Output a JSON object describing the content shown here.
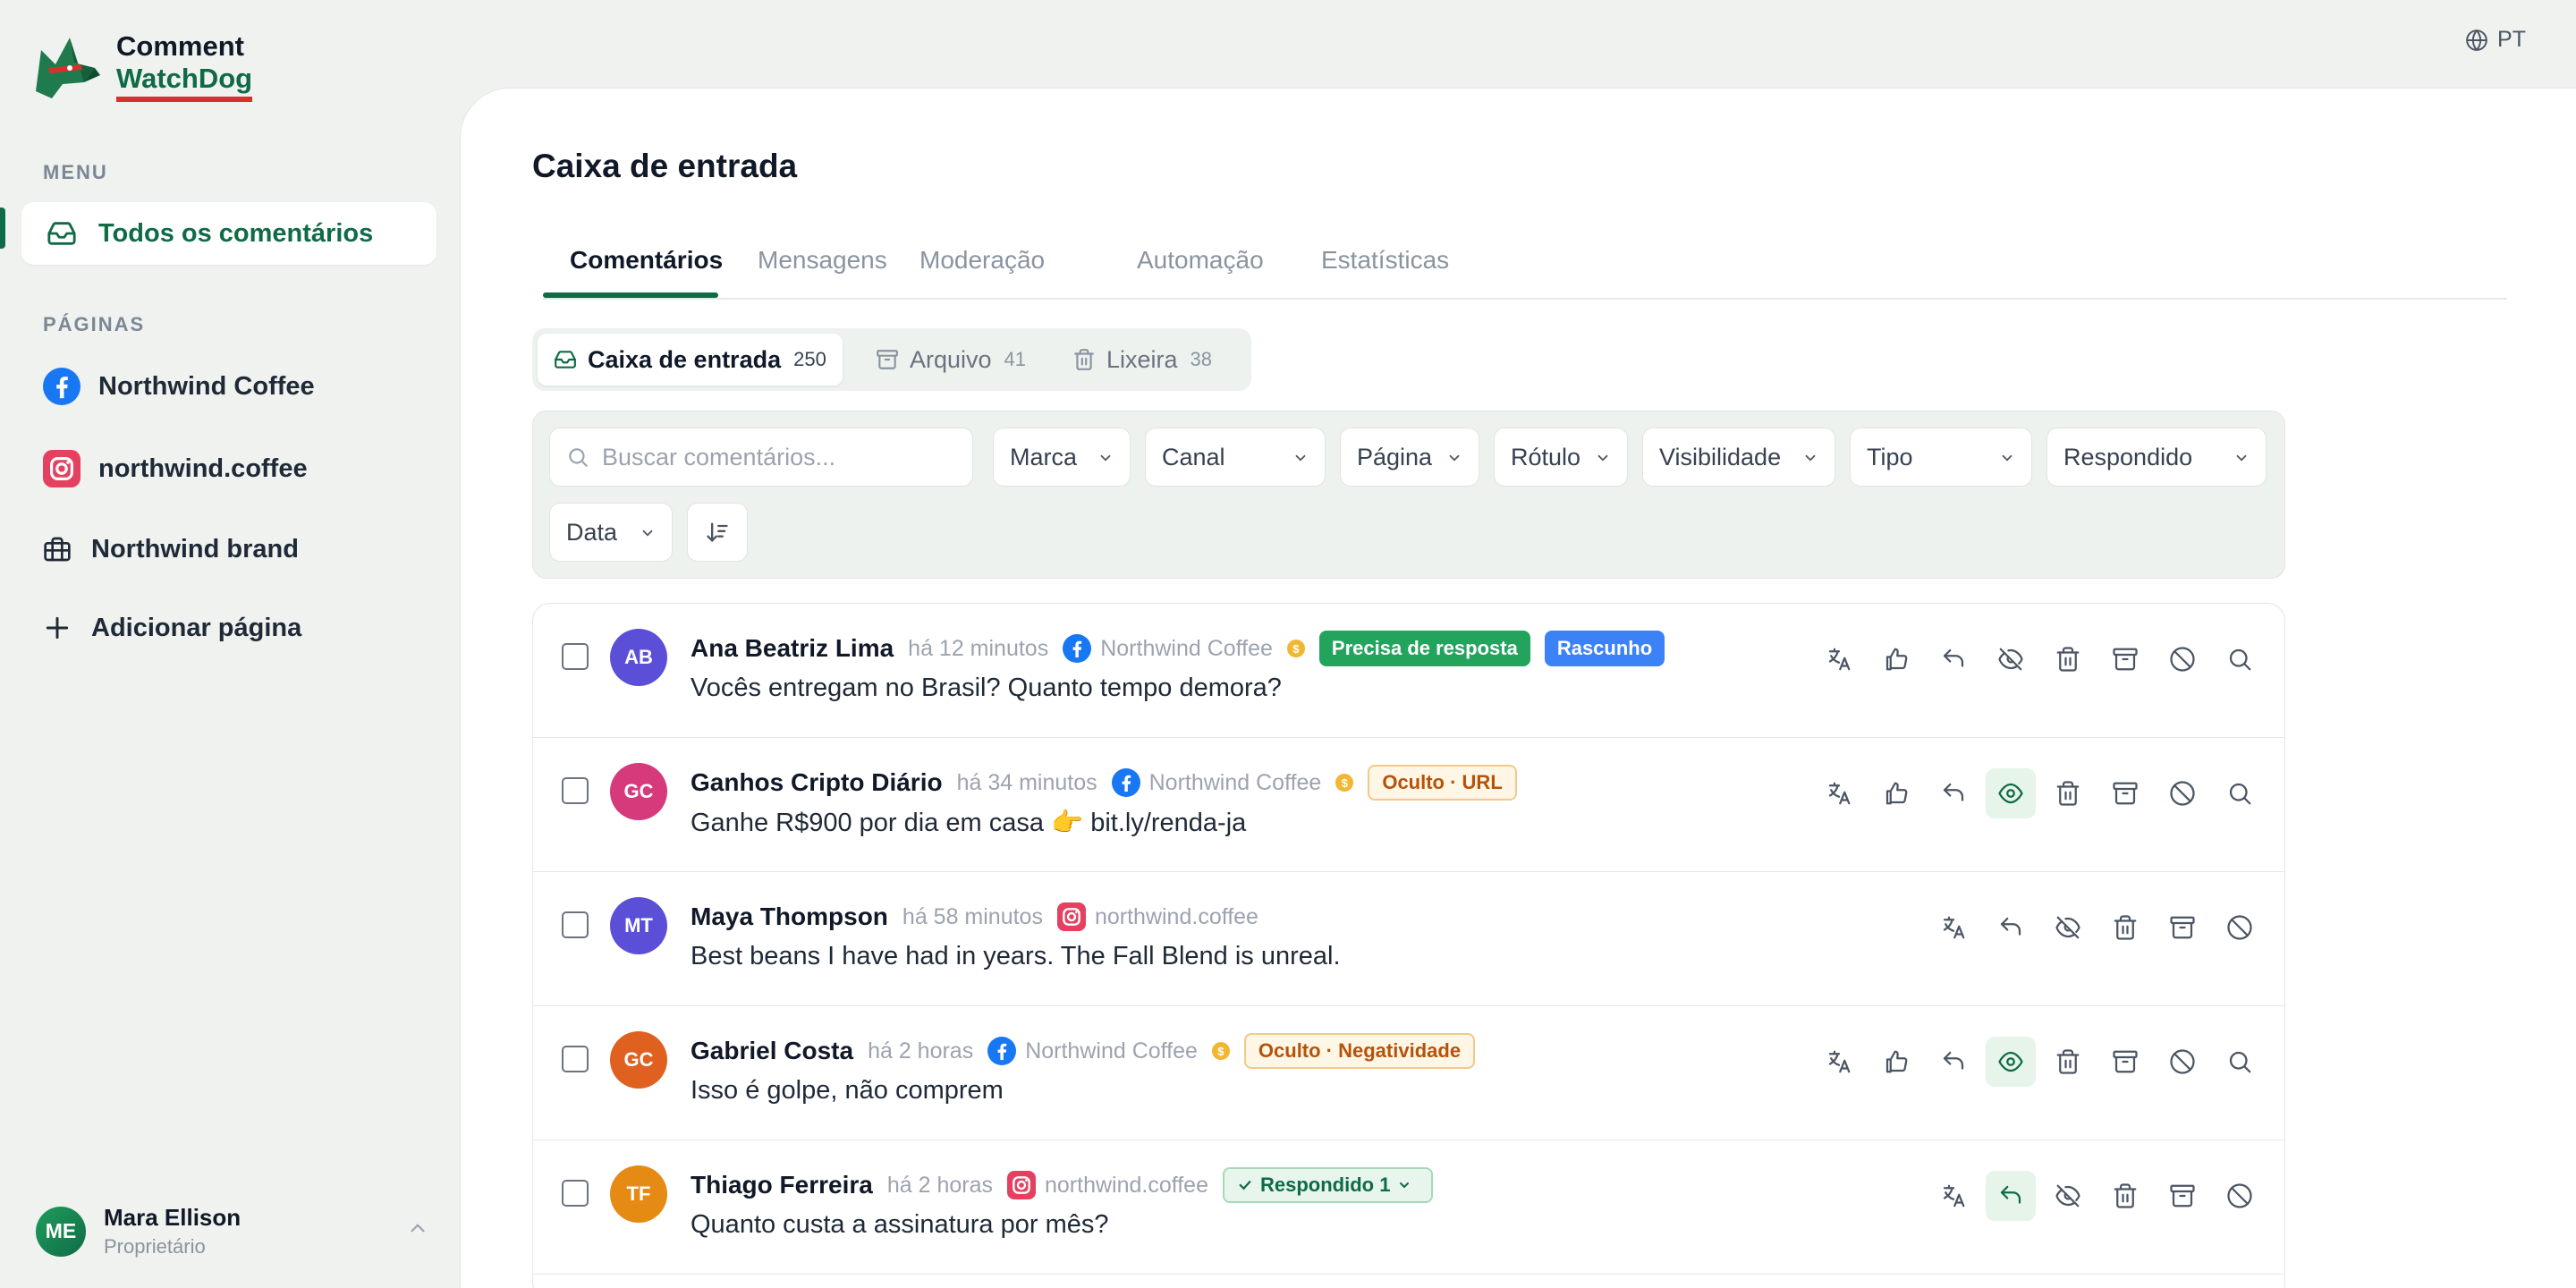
{
  "app": {
    "name_line1": "Comment",
    "name_line2": "WatchDog",
    "language": "PT"
  },
  "sidebar": {
    "menu_label": "MENU",
    "menu_items": [
      {
        "label": "Todos os comentários",
        "icon": "inbox-icon",
        "active": true
      }
    ],
    "pages_label": "PÁGINAS",
    "pages": [
      {
        "label": "Northwind Coffee",
        "icon": "facebook-icon"
      },
      {
        "label": "northwind.coffee",
        "icon": "instagram-icon"
      },
      {
        "label": "Northwind brand",
        "icon": "briefcase-icon"
      },
      {
        "label": "Adicionar página",
        "icon": "plus-icon"
      }
    ],
    "user": {
      "initials": "ME",
      "name": "Mara Ellison",
      "role": "Proprietário"
    }
  },
  "main": {
    "title": "Caixa de entrada",
    "tabs": [
      {
        "label": "Comentários",
        "active": true
      },
      {
        "label": "Mensagens"
      },
      {
        "label": "Moderação"
      },
      {
        "label": "Automação"
      },
      {
        "label": "Estatísticas"
      }
    ],
    "folders": [
      {
        "label": "Caixa de entrada",
        "count": "250",
        "icon": "inbox-icon",
        "active": true
      },
      {
        "label": "Arquivo",
        "count": "41",
        "icon": "archive-icon"
      },
      {
        "label": "Lixeira",
        "count": "38",
        "icon": "trash-icon"
      }
    ],
    "search_placeholder": "Buscar comentários...",
    "filters": [
      "Marca",
      "Canal",
      "Página",
      "Rótulo",
      "Visibilidade",
      "Tipo",
      "Respondido",
      "Data"
    ]
  },
  "comments": [
    {
      "initials": "AB",
      "author": "Ana Beatriz Lima",
      "time": "há 12 minutos",
      "platform": "facebook",
      "page": "Northwind Coffee",
      "coin": "$",
      "tags": [
        {
          "text": "Precisa de resposta",
          "style": "green"
        },
        {
          "text": "Rascunho",
          "style": "blue"
        }
      ],
      "text": "Vocês entregam no Brasil? Quanto tempo demora?",
      "avatar_color": "#5b4fd8",
      "actions": [
        "translate",
        "like",
        "reply",
        "hide",
        "delete",
        "archive",
        "ban",
        "search"
      ],
      "active_action": ""
    },
    {
      "initials": "GC",
      "author": "Ganhos Cripto Diário",
      "time": "há 34 minutos",
      "platform": "facebook",
      "page": "Northwind Coffee",
      "coin": "$",
      "tags": [
        {
          "text": "Oculto · URL",
          "style": "warn"
        }
      ],
      "text": "Ganhe R$900 por dia em casa 👉 bit.ly/renda-ja",
      "avatar_color": "#d63a7a",
      "actions": [
        "translate",
        "like",
        "reply",
        "show",
        "delete",
        "archive",
        "ban",
        "search"
      ],
      "active_action": "show"
    },
    {
      "initials": "MT",
      "author": "Maya Thompson",
      "time": "há 58 minutos",
      "platform": "instagram",
      "page": "northwind.coffee",
      "coin": "",
      "tags": [],
      "text": "Best beans I have had in years. The Fall Blend is unreal.",
      "avatar_color": "#5b4fd8",
      "actions": [
        "translate",
        "reply",
        "hide",
        "delete",
        "archive",
        "ban"
      ],
      "active_action": ""
    },
    {
      "initials": "GC",
      "author": "Gabriel Costa",
      "time": "há 2 horas",
      "platform": "facebook",
      "page": "Northwind Coffee",
      "coin": "$",
      "tags": [
        {
          "text": "Oculto · Negatividade",
          "style": "warn"
        }
      ],
      "text": "Isso é golpe, não comprem",
      "avatar_color": "#e0611f",
      "actions": [
        "translate",
        "like",
        "reply",
        "show",
        "delete",
        "archive",
        "ban",
        "search"
      ],
      "active_action": "show"
    },
    {
      "initials": "TF",
      "author": "Thiago Ferreira",
      "time": "há 2 horas",
      "platform": "instagram",
      "page": "northwind.coffee",
      "coin": "",
      "tags": [
        {
          "text": "Respondido 1",
          "style": "replied"
        }
      ],
      "text": "Quanto custa a assinatura por mês?",
      "avatar_color": "#e58a12",
      "actions": [
        "translate",
        "reply",
        "hide",
        "delete",
        "archive",
        "ban"
      ],
      "active_action": "reply"
    }
  ],
  "colors": {
    "brand": "#0f6b45",
    "accent_red": "#d6322b",
    "facebook": "#1877f2",
    "instagram": "#e4405f"
  }
}
